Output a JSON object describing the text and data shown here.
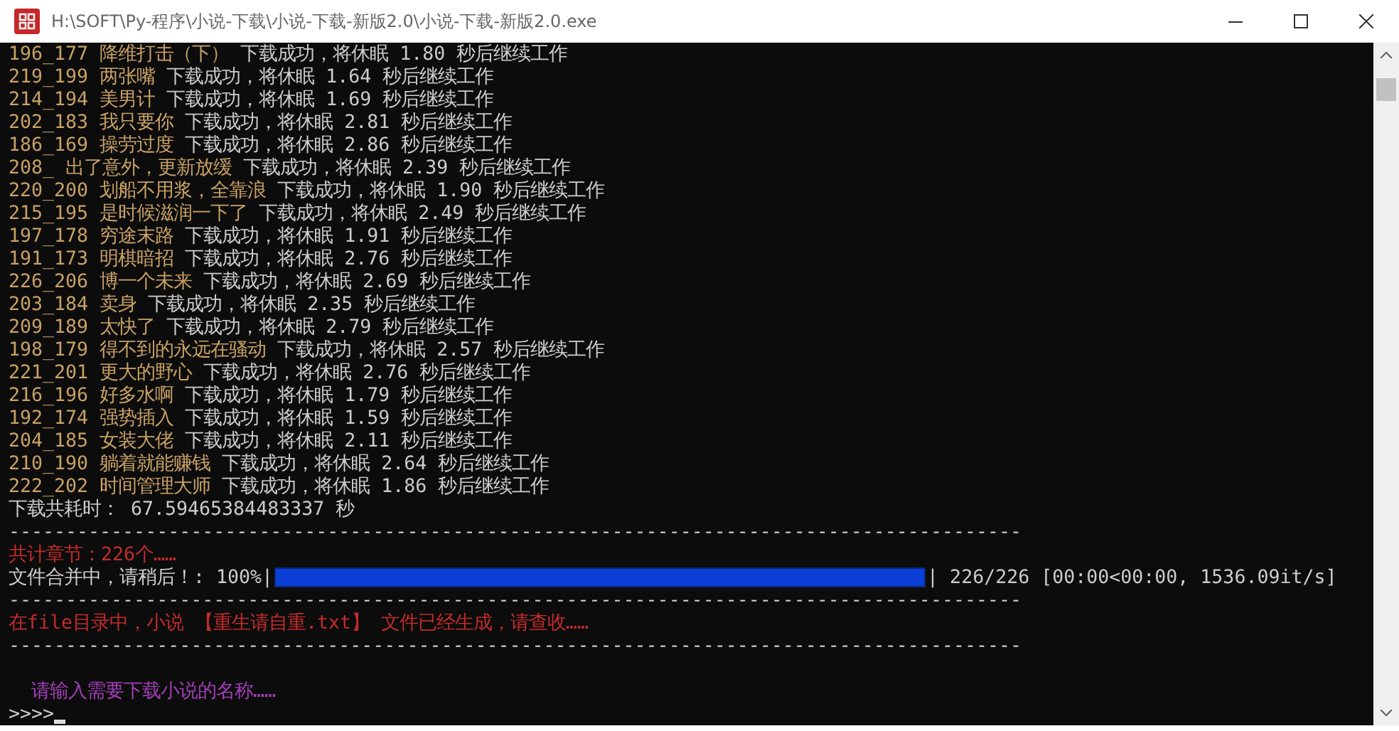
{
  "window": {
    "title": "H:\\SOFT\\Py-程序\\小说-下载\\小说-下载-新版2.0\\小说-下载-新版2.0.exe"
  },
  "console": {
    "lines": [
      {
        "kind": "download",
        "id": "196_177",
        "title": "降维打击（下）",
        "status": "下载成功，将休眠 1.80 秒后继续工作"
      },
      {
        "kind": "download",
        "id": "219_199",
        "title": "两张嘴",
        "status": "下载成功，将休眠 1.64 秒后继续工作"
      },
      {
        "kind": "download",
        "id": "214_194",
        "title": "美男计",
        "status": "下载成功，将休眠 1.69 秒后继续工作"
      },
      {
        "kind": "download",
        "id": "202_183",
        "title": "我只要你",
        "status": "下载成功，将休眠 2.81 秒后继续工作"
      },
      {
        "kind": "download",
        "id": "186_169",
        "title": "操劳过度",
        "status": "下载成功，将休眠 2.86 秒后继续工作"
      },
      {
        "kind": "download",
        "id": "208_",
        "title": "出了意外，更新放缓",
        "status": "下载成功，将休眠 2.39 秒后继续工作"
      },
      {
        "kind": "download",
        "id": "220_200",
        "title": "划船不用浆，全靠浪",
        "status": "下载成功，将休眠 1.90 秒后继续工作"
      },
      {
        "kind": "download",
        "id": "215_195",
        "title": "是时候滋润一下了",
        "status": "下载成功，将休眠 2.49 秒后继续工作"
      },
      {
        "kind": "download",
        "id": "197_178",
        "title": "穷途末路",
        "status": "下载成功，将休眠 1.91 秒后继续工作"
      },
      {
        "kind": "download",
        "id": "191_173",
        "title": "明棋暗招",
        "status": "下载成功，将休眠 2.76 秒后继续工作"
      },
      {
        "kind": "download",
        "id": "226_206",
        "title": "博一个未来",
        "status": "下载成功，将休眠 2.69 秒后继续工作"
      },
      {
        "kind": "download",
        "id": "203_184",
        "title": "卖身",
        "status": "下载成功，将休眠 2.35 秒后继续工作"
      },
      {
        "kind": "download",
        "id": "209_189",
        "title": "太快了",
        "status": "下载成功，将休眠 2.79 秒后继续工作"
      },
      {
        "kind": "download",
        "id": "198_179",
        "title": "得不到的永远在骚动",
        "status": "下载成功，将休眠 2.57 秒后继续工作"
      },
      {
        "kind": "download",
        "id": "221_201",
        "title": "更大的野心",
        "status": "下载成功，将休眠 2.76 秒后继续工作"
      },
      {
        "kind": "download",
        "id": "216_196",
        "title": "好多水啊",
        "status": "下载成功，将休眠 1.79 秒后继续工作"
      },
      {
        "kind": "download",
        "id": "192_174",
        "title": "强势插入",
        "status": "下载成功，将休眠 1.59 秒后继续工作"
      },
      {
        "kind": "download",
        "id": "204_185",
        "title": "女装大佬",
        "status": "下载成功，将休眠 2.11 秒后继续工作"
      },
      {
        "kind": "download",
        "id": "210_190",
        "title": "躺着就能赚钱",
        "status": "下载成功，将休眠 2.64 秒后继续工作"
      },
      {
        "kind": "download",
        "id": "222_202",
        "title": "时间管理大师",
        "status": "下载成功，将休眠 1.86 秒后继续工作"
      },
      {
        "kind": "text",
        "text": "下载共耗时： 67.59465384483337 秒",
        "color": "#cccccc"
      },
      {
        "kind": "rule",
        "text": "-----------------------------------------------------------------------------------------"
      },
      {
        "kind": "text",
        "text": "共计章节：226个……",
        "color": "#c42b2b"
      },
      {
        "kind": "progress",
        "label": "文件合并中，请稍后！: 100%|",
        "level": 1,
        "stats": "| 226/226 [00:00<00:00, 1536.09it/s]"
      },
      {
        "kind": "rule",
        "text": "-----------------------------------------------------------------------------------------"
      },
      {
        "kind": "text",
        "text": "在file目录中，小说 【重生请自重.txt】 文件已经生成，请查收……",
        "color": "#c42b2b"
      },
      {
        "kind": "rule",
        "text": "-----------------------------------------------------------------------------------------"
      },
      {
        "kind": "blank"
      },
      {
        "kind": "prompt",
        "text": "请输入需要下载小说的名称……",
        "color": "#a23fb8"
      },
      {
        "kind": "input",
        "text": ">>>>"
      }
    ]
  }
}
